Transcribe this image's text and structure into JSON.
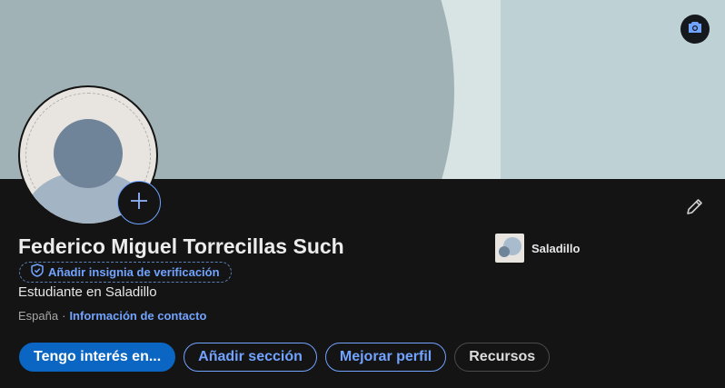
{
  "profile": {
    "name": "Federico Miguel Torrecillas Such",
    "verification_badge_label": "Añadir insignia de verificación",
    "headline": "Estudiante en Saladillo",
    "location": "España",
    "separator": "·",
    "contact_info_link": "Información de contacto"
  },
  "company": {
    "name": "Saladillo"
  },
  "actions": {
    "open_to": "Tengo interés en...",
    "add_section": "Añadir sección",
    "enhance_profile": "Mejorar perfil",
    "resources": "Recursos"
  },
  "icons": {
    "camera": "camera-icon",
    "add_photo": "plus-icon",
    "edit": "pencil-icon",
    "badge": "shield-check-icon"
  },
  "colors": {
    "accent": "#71a3ff",
    "primary_button": "#0a66c2",
    "card_background": "#141414"
  }
}
